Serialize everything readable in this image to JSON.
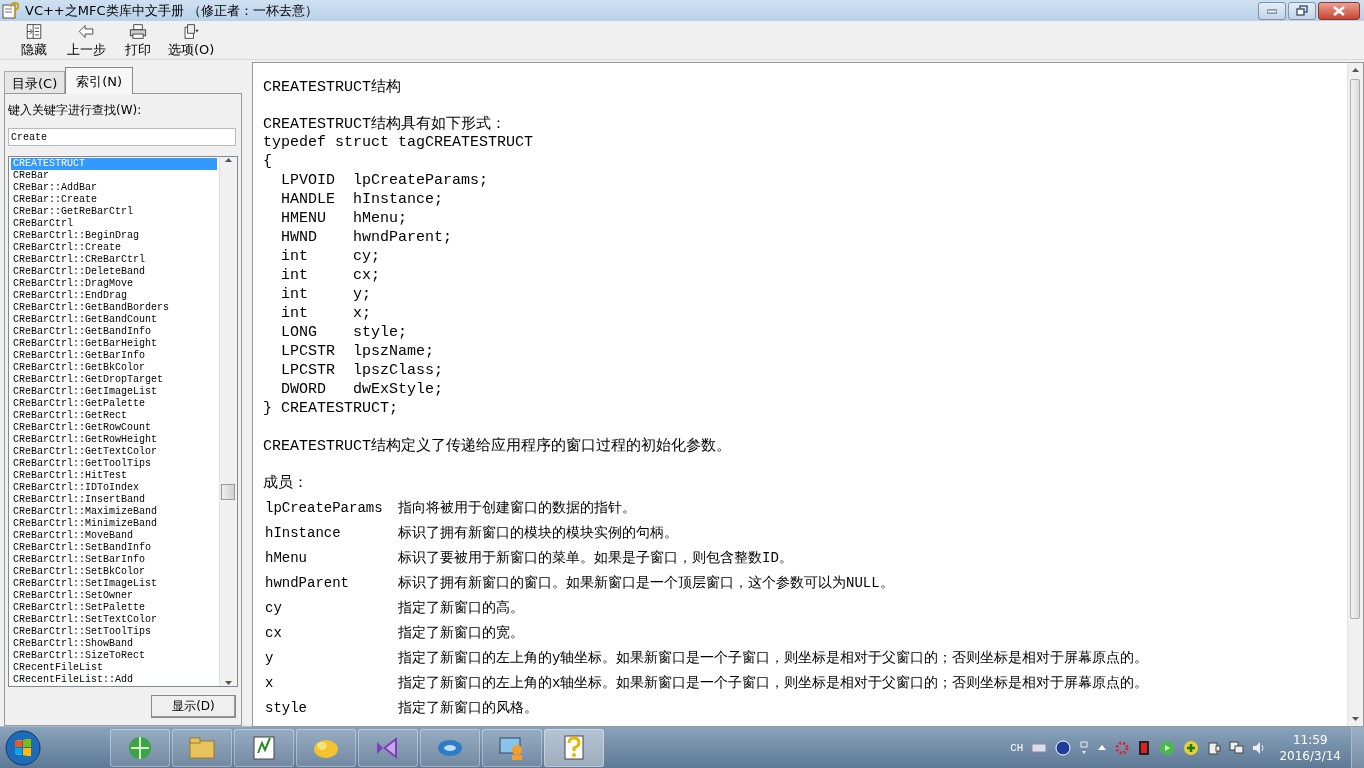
{
  "window": {
    "title": "VC++之MFC类库中文手册 （修正者：一杯去意）"
  },
  "toolbar": {
    "buttons": [
      {
        "kind": "hide",
        "label": "隐藏"
      },
      {
        "kind": "back",
        "label": "上一步"
      },
      {
        "kind": "print",
        "label": "打印"
      },
      {
        "kind": "options",
        "label": "选项(O)"
      }
    ]
  },
  "nav": {
    "tabs": [
      {
        "label": "目录(C)",
        "selected": false
      },
      {
        "label": "索引(N)",
        "selected": true
      }
    ],
    "prompt": "键入关键字进行查找(W):",
    "search": {
      "value": "Create"
    },
    "items": [
      {
        "label": "CREATESTRUCT",
        "selected": true
      },
      {
        "label": "CReBar",
        "selected": false
      },
      {
        "label": "CReBar::AddBar",
        "selected": false
      },
      {
        "label": "CReBar::Create",
        "selected": false
      },
      {
        "label": "CReBar::GetReBarCtrl",
        "selected": false
      },
      {
        "label": "CReBarCtrl",
        "selected": false
      },
      {
        "label": "CReBarCtrl::BeginDrag",
        "selected": false
      },
      {
        "label": "CReBarCtrl::Create",
        "selected": false
      },
      {
        "label": "CReBarCtrl::CReBarCtrl",
        "selected": false
      },
      {
        "label": "CReBarCtrl::DeleteBand",
        "selected": false
      },
      {
        "label": "CReBarCtrl::DragMove",
        "selected": false
      },
      {
        "label": "CReBarCtrl::EndDrag",
        "selected": false
      },
      {
        "label": "CReBarCtrl::GetBandBorders",
        "selected": false
      },
      {
        "label": "CReBarCtrl::GetBandCount",
        "selected": false
      },
      {
        "label": "CReBarCtrl::GetBandInfo",
        "selected": false
      },
      {
        "label": "CReBarCtrl::GetBarHeight",
        "selected": false
      },
      {
        "label": "CReBarCtrl::GetBarInfo",
        "selected": false
      },
      {
        "label": "CReBarCtrl::GetBkColor",
        "selected": false
      },
      {
        "label": "CReBarCtrl::GetDropTarget",
        "selected": false
      },
      {
        "label": "CReBarCtrl::GetImageList",
        "selected": false
      },
      {
        "label": "CReBarCtrl::GetPalette",
        "selected": false
      },
      {
        "label": "CReBarCtrl::GetRect",
        "selected": false
      },
      {
        "label": "CReBarCtrl::GetRowCount",
        "selected": false
      },
      {
        "label": "CReBarCtrl::GetRowHeight",
        "selected": false
      },
      {
        "label": "CReBarCtrl::GetTextColor",
        "selected": false
      },
      {
        "label": "CReBarCtrl::GetToolTips",
        "selected": false
      },
      {
        "label": "CReBarCtrl::HitTest",
        "selected": false
      },
      {
        "label": "CReBarCtrl::IDToIndex",
        "selected": false
      },
      {
        "label": "CReBarCtrl::InsertBand",
        "selected": false
      },
      {
        "label": "CReBarCtrl::MaximizeBand",
        "selected": false
      },
      {
        "label": "CReBarCtrl::MinimizeBand",
        "selected": false
      },
      {
        "label": "CReBarCtrl::MoveBand",
        "selected": false
      },
      {
        "label": "CReBarCtrl::SetBandInfo",
        "selected": false
      },
      {
        "label": "CReBarCtrl::SetBarInfo",
        "selected": false
      },
      {
        "label": "CReBarCtrl::SetBkColor",
        "selected": false
      },
      {
        "label": "CReBarCtrl::SetImageList",
        "selected": false
      },
      {
        "label": "CReBarCtrl::SetOwner",
        "selected": false
      },
      {
        "label": "CReBarCtrl::SetPalette",
        "selected": false
      },
      {
        "label": "CReBarCtrl::SetTextColor",
        "selected": false
      },
      {
        "label": "CReBarCtrl::SetToolTips",
        "selected": false
      },
      {
        "label": "CReBarCtrl::ShowBand",
        "selected": false
      },
      {
        "label": "CReBarCtrl::SizeToRect",
        "selected": false
      },
      {
        "label": "CRecentFileList",
        "selected": false
      },
      {
        "label": "CRecentFileList::Add",
        "selected": false
      }
    ],
    "show_button": "显示(D)"
  },
  "content": {
    "heading": "CREATESTRUCT结构",
    "intro": "CREATESTRUCT结构具有如下形式：",
    "code": [
      "typedef struct tagCREATESTRUCT",
      "{",
      "  LPVOID  lpCreateParams;",
      "  HANDLE  hInstance;",
      "  HMENU   hMenu;",
      "  HWND    hwndParent;",
      "  int     cy;",
      "  int     cx;",
      "  int     y;",
      "  int     x;",
      "  LONG    style;",
      "  LPCSTR  lpszName;",
      "  LPCSTR  lpszClass;",
      "  DWORD   dwExStyle;",
      "} CREATESTRUCT;"
    ],
    "description": "CREATESTRUCT结构定义了传递给应用程序的窗口过程的初始化参数。",
    "members_label": "成员：",
    "members": [
      {
        "name": "lpCreateParams",
        "desc": "指向将被用于创建窗口的数据的指针。"
      },
      {
        "name": "hInstance",
        "desc": "标识了拥有新窗口的模块的模块实例的句柄。"
      },
      {
        "name": "hMenu",
        "desc": "标识了要被用于新窗口的菜单。如果是子窗口，则包含整数ID。"
      },
      {
        "name": "hwndParent",
        "desc": "标识了拥有新窗口的窗口。如果新窗口是一个顶层窗口，这个参数可以为NULL。"
      },
      {
        "name": "cy",
        "desc": "指定了新窗口的高。"
      },
      {
        "name": "cx",
        "desc": "指定了新窗口的宽。"
      },
      {
        "name": "y",
        "desc": "指定了新窗口的左上角的y轴坐标。如果新窗口是一个子窗口，则坐标是相对于父窗口的；否则坐标是相对于屏幕原点的。"
      },
      {
        "name": "x",
        "desc": "指定了新窗口的左上角的x轴坐标。如果新窗口是一个子窗口，则坐标是相对于父窗口的；否则坐标是相对于屏幕原点的。"
      },
      {
        "name": "style",
        "desc": "指定了新窗口的风格。"
      }
    ]
  },
  "taskbar": {
    "apps": [
      {
        "kind": "browser",
        "active": false
      },
      {
        "kind": "folder",
        "active": false
      },
      {
        "kind": "editor",
        "active": false
      },
      {
        "kind": "cloud",
        "active": false
      },
      {
        "kind": "studio",
        "active": false
      },
      {
        "kind": "disc",
        "active": false
      },
      {
        "kind": "network",
        "active": false
      },
      {
        "kind": "help",
        "active": true
      }
    ],
    "language": "CH",
    "time": "11:59",
    "date": "2016/3/14"
  }
}
